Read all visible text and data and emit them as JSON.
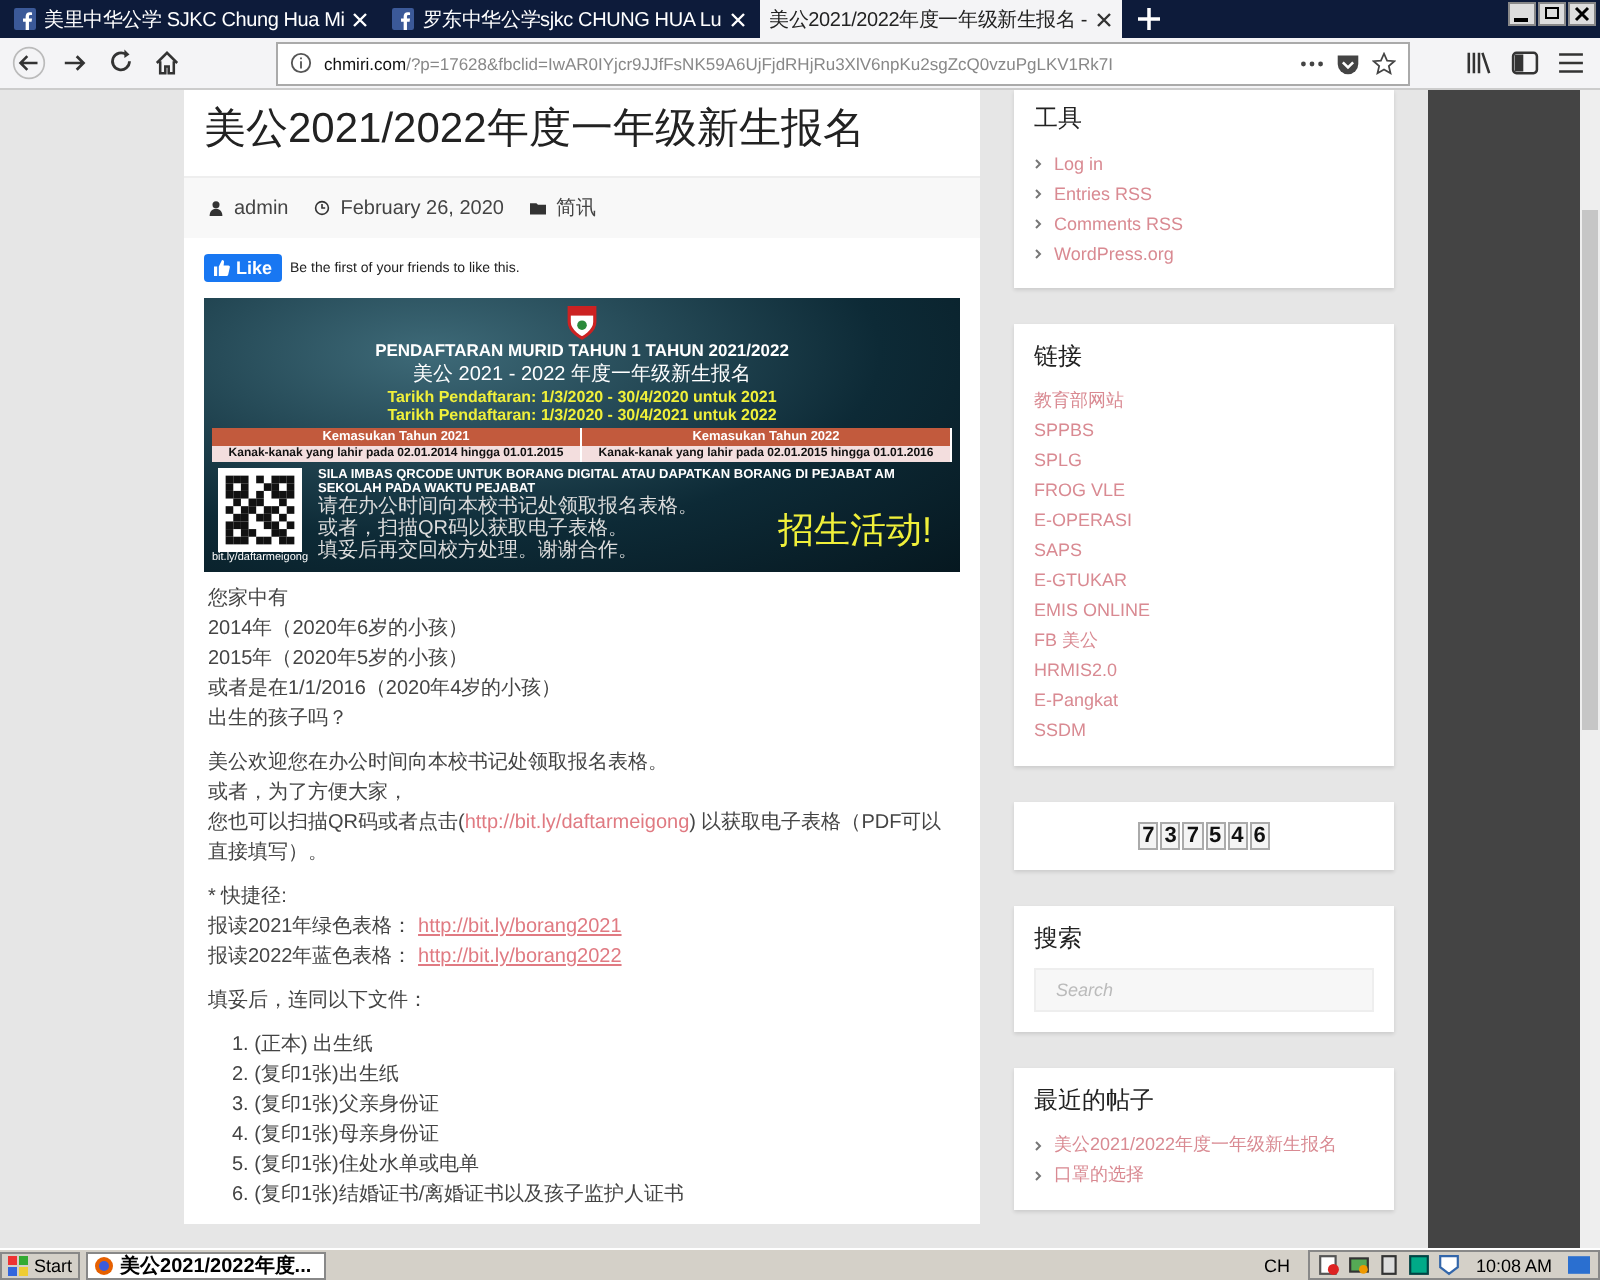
{
  "browser": {
    "tabs": [
      {
        "title": "美里中华公学 SJKC Chung Hua Mi",
        "selected": false
      },
      {
        "title": "罗东中华公学sjkc CHUNG HUA Lu",
        "selected": false
      },
      {
        "title": "美公2021/2022年度一年级新生报名 -",
        "selected": true
      }
    ],
    "url_host": "chmiri.com",
    "url_rest": "/?p=17628&fbclid=IwAR0IYjcr9JJfFsNK59A6UjFjdRHjRu3XlV6npKu2sgZcQ0vzuPgLKV1Rk7I"
  },
  "post": {
    "title": "美公2021/2022年度一年级新生报名",
    "author": "admin",
    "date": "February 26, 2020",
    "category": "简讯",
    "like_button": "Like",
    "like_text": "Be the first of your friends to like this.",
    "banner": {
      "title": "PENDAFTARAN MURID TAHUN 1 TAHUN 2021/2022",
      "subtitle": "美公 2021 - 2022 年度一年级新生报名",
      "dates": [
        "Tarikh Pendaftaran: 1/3/2020 - 30/4/2020 untuk 2021",
        "Tarikh Pendaftaran: 1/3/2020 - 30/4/2021 untuk 2022"
      ],
      "table_headers": [
        "Kemasukan Tahun 2021",
        "Kemasukan Tahun 2022"
      ],
      "table_cells": [
        "Kanak-kanak yang lahir pada 02.01.2014 hingga 01.01.2015",
        "Kanak-kanak yang lahir pada 02.01.2015 hingga 01.01.2016"
      ],
      "notice": "SILA IMBAS QRCODE UNTUK BORANG DIGITAL ATAU DAPATKAN BORANG DI PEJABAT AM SEKOLAH PADA WAKTU PEJABAT",
      "notice_lines": [
        "请在办公时间向本校书记处领取报名表格。",
        "或者，扫描QR码以获取电子表格。",
        "填妥后再交回校方处理。谢谢合作。"
      ],
      "qr_caption": "bit.ly/daftarmeigong",
      "slogan": "招生活动!"
    },
    "para1": [
      "您家中有",
      "2014年（2020年6岁的小孩）",
      "2015年（2020年5岁的小孩）",
      "或者是在1/1/2016（2020年4岁的小孩）",
      "出生的孩子吗？"
    ],
    "para2": [
      "美公欢迎您在办公时间向本校书记处领取报名表格。",
      "或者，为了方便大家，"
    ],
    "para2_link": {
      "before": "您也可以扫描QR码或者点击(",
      "link": "http://bit.ly/daftarmeigong",
      "after": ") 以获取电子表格（PDF可以直接填写）。"
    },
    "shortcut_label": "* 快捷径:",
    "shortcuts": [
      {
        "label": "报读2021年绿色表格：",
        "link": "http://bit.ly/borang2021"
      },
      {
        "label": "报读2022年蓝色表格：",
        "link": "http://bit.ly/borang2022"
      }
    ],
    "para3": "填妥后，连同以下文件：",
    "documents": [
      "1. (正本) 出生纸",
      "2. (复印1张)出生纸",
      "3. (复印1张)父亲身份证",
      "4. (复印1张)母亲身份证",
      "5. (复印1张)住处水单或电单",
      "6. (复印1张)结婚证书/离婚证书以及孩子监护人证书"
    ]
  },
  "sidebar": {
    "tools_title": "工具",
    "tools": [
      "Log in",
      "Entries RSS",
      "Comments RSS",
      "WordPress.org"
    ],
    "links_title": "链接",
    "links": [
      "教育部网站",
      "SPPBS",
      "SPLG",
      "FROG VLE",
      "E-OPERASI",
      "SAPS",
      "E-GTUKAR",
      "EMIS ONLINE",
      "FB 美公",
      "HRMIS2.0",
      "E-Pangkat",
      "SSDM"
    ],
    "counter": [
      "7",
      "3",
      "7",
      "5",
      "4",
      "6"
    ],
    "search_title": "搜索",
    "search": {
      "placeholder": "Search"
    },
    "recent_title": "最近的帖子",
    "recent": [
      "美公2021/2022年度一年级新生报名",
      "口罩的选择"
    ]
  },
  "taskbar": {
    "start": "Start",
    "task": "美公2021/2022年度...",
    "language": "CH",
    "clock": "10:08 AM"
  }
}
